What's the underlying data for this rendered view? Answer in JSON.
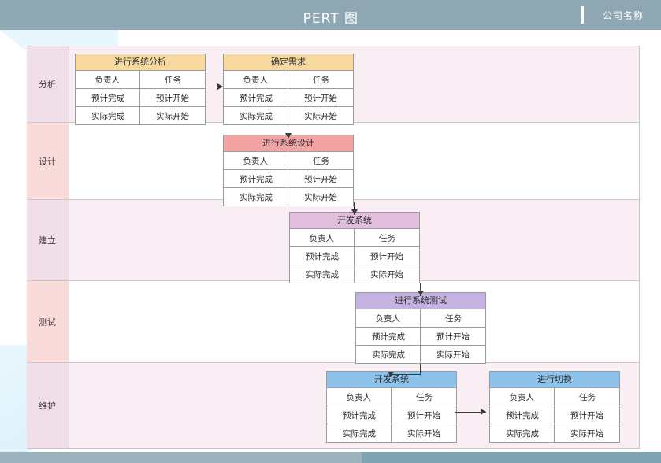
{
  "header": {
    "company": "公司名称",
    "title": "PERT 图"
  },
  "lanes": [
    {
      "label": "分析",
      "tone": "l-pink",
      "band": "pink"
    },
    {
      "label": "设计",
      "tone": "l-red",
      "band": "white"
    },
    {
      "label": "建立",
      "tone": "l-pink",
      "band": "pink"
    },
    {
      "label": "测试",
      "tone": "l-red",
      "band": "white"
    },
    {
      "label": "维护",
      "tone": "l-pink",
      "band": "pink"
    }
  ],
  "card_fields": {
    "task": "任务",
    "owner": "负责人",
    "planned_start": "预计开始",
    "planned_end": "预计完成",
    "actual_start": "实际开始",
    "actual_end": "实际完成"
  },
  "tasks": [
    {
      "id": "t-confirm-requirements",
      "title": "确定需求",
      "header_color": "#f7d9a0",
      "lane": "分析"
    },
    {
      "id": "t-system-analysis",
      "title": "进行系统分析",
      "header_color": "#f7d9a0",
      "lane": "分析"
    },
    {
      "id": "t-system-design",
      "title": "进行系统设计",
      "header_color": "#f2a3a3",
      "lane": "设计"
    },
    {
      "id": "t-develop-system-build",
      "title": "开发系统",
      "header_color": "#e2bedd",
      "lane": "建立"
    },
    {
      "id": "t-system-test",
      "title": "进行系统测试",
      "header_color": "#c4b3e0",
      "lane": "测试"
    },
    {
      "id": "t-develop-system-maint",
      "title": "开发系统",
      "header_color": "#8dc2ea",
      "lane": "维护"
    },
    {
      "id": "t-switchover",
      "title": "进行切换",
      "header_color": "#8dc2ea",
      "lane": "维护"
    }
  ],
  "colors": {
    "header_bar": "#8fa7b2",
    "lane_pink": "#f9eef4",
    "lane_white": "#ffffff",
    "label_pink": "#f0dfe9",
    "label_red": "#f9dcd9",
    "frame_border": "#cfc3cb",
    "connector": "#3a3a3a",
    "bottom_strip": "#9cb3bd"
  }
}
